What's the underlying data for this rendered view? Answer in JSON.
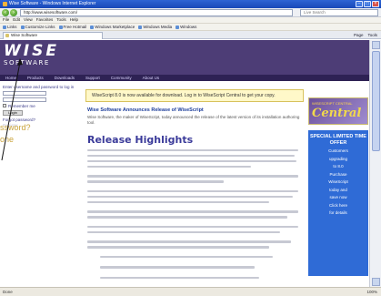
{
  "browser": {
    "title": "Wise Software - Windows Internet Explorer",
    "url": "http://www.wisesoftware.com/",
    "search_placeholder": "Live Search",
    "menu": [
      "File",
      "Edit",
      "View",
      "Favorites",
      "Tools",
      "Help"
    ],
    "links": [
      "Links",
      "Customize Links",
      "Free Hotmail",
      "Windows Marketplace",
      "Windows Media",
      "Windows"
    ],
    "tab_title": "Wise Software",
    "tab_tools": [
      "Page",
      "Tools"
    ],
    "status": "Done",
    "zoom": "100%"
  },
  "site": {
    "logo_big": "WISE",
    "logo_small": "SOFTWARE",
    "nav": [
      "Home",
      "Products",
      "Downloads",
      "Support",
      "Community",
      "About Us"
    ]
  },
  "sidebar": {
    "login_text": "Enter username and password to log in",
    "remember": "Remember me",
    "login_button": "Login",
    "forgot": "Forgot password?",
    "register": "Register",
    "pointer_line1": "ssword?",
    "pointer_line2": "one"
  },
  "main": {
    "alert": "WiseScript 8.0 is now available for download. Log in to WiseScript Central to get your copy.",
    "news_head": "Wise Software Announces Release of WiseScript",
    "news_para": "Wise Software, the maker of WiseScript, today announced the release of the latest version of its installation authoring tool.",
    "release_title": "Release Highlights"
  },
  "rightbar": {
    "banner_top": "WISESCRIPT CENTRAL",
    "banner_word": "Central",
    "promo_title": "SPECIAL LIMITED TIME OFFER",
    "promo_lines": [
      "Customers",
      "upgrading",
      "to 8.0",
      "Purchase",
      "WiseScript",
      "today and",
      "save now",
      "Click here",
      "for details"
    ]
  },
  "colors": {
    "header": "#4d3d76",
    "navbar": "#2e2254",
    "promo": "#2f6bd6",
    "alert_bg": "#fff8c9",
    "pointer_text": "#c9a33a"
  }
}
